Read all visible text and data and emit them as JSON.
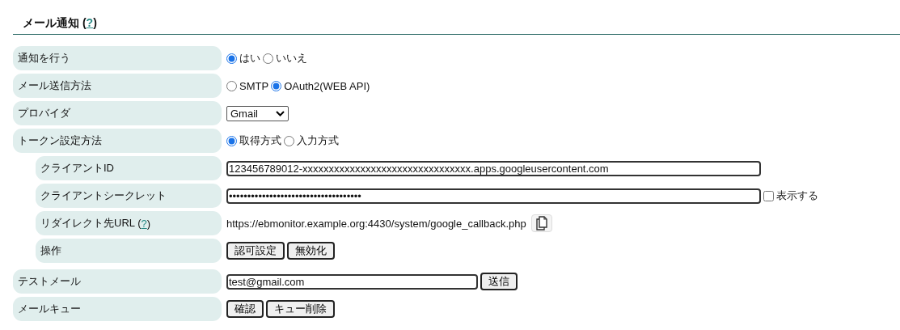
{
  "section": {
    "title": "メール通知 (",
    "help": "?",
    "title_end": ")"
  },
  "rows": [
    {
      "label": "通知を行う",
      "kind": "radio",
      "options": [
        {
          "label": "はい",
          "selected": true
        },
        {
          "label": "いいえ",
          "selected": false
        }
      ]
    },
    {
      "label": "メール送信方法",
      "kind": "radio",
      "options": [
        {
          "label": "SMTP",
          "selected": false
        },
        {
          "label": "OAuth2(WEB API)",
          "selected": true
        }
      ]
    },
    {
      "label": "プロバイダ",
      "kind": "select",
      "value": "Gmail"
    },
    {
      "label": "トークン設定方法",
      "kind": "radio",
      "options": [
        {
          "label": "取得方式",
          "selected": true
        },
        {
          "label": "入力方式",
          "selected": false
        }
      ],
      "children": [
        {
          "label": "クライアントID",
          "kind": "input",
          "value": "123456789012-xxxxxxxxxxxxxxxxxxxxxxxxxxxxxxxx.apps.googleusercontent.com"
        },
        {
          "label": "クライアントシークレット",
          "kind": "password",
          "value": "••••••••••••••••••••••••••••••••••••",
          "checkbox": {
            "label": "表示する",
            "checked": false
          }
        },
        {
          "label": "リダイレクト先URL (",
          "help": "?",
          "label_end": ")",
          "kind": "url",
          "value": "https://ebmonitor.example.org:4430/system/google_callback.php"
        },
        {
          "label": "操作",
          "kind": "buttons",
          "buttons": [
            "認可設定",
            "無効化"
          ]
        }
      ]
    },
    {
      "label": "テストメール",
      "kind": "input_button",
      "value": "test@gmail.com",
      "buttons": [
        "送信"
      ]
    },
    {
      "label": "メールキュー",
      "kind": "buttons",
      "buttons": [
        "確認",
        "キュー削除"
      ]
    }
  ]
}
